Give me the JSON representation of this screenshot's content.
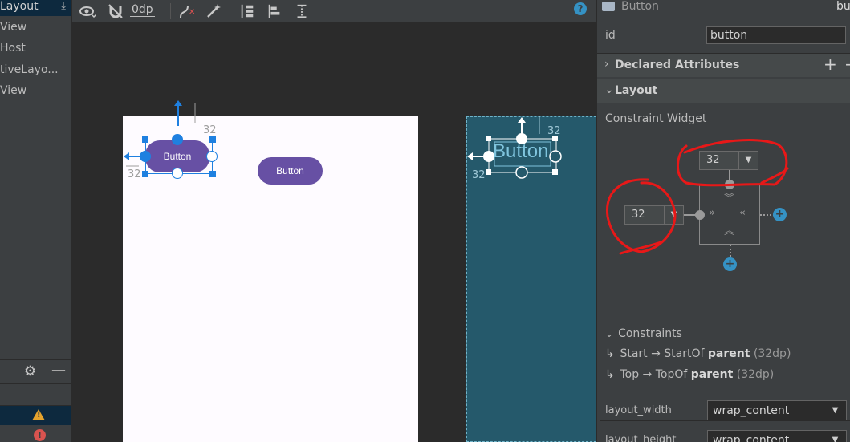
{
  "component_tree": {
    "items": [
      "Layout",
      "View",
      "Host",
      "tiveLayo...",
      "View"
    ]
  },
  "toolbar": {
    "default_margin": "0dp",
    "help": "?"
  },
  "canvas": {
    "selected_button_label": "Button",
    "second_button_label": "Button",
    "blueprint_button_label": "Button",
    "margin_top": "32",
    "margin_start": "32",
    "bp_margin_top": "32",
    "bp_margin_start": "32"
  },
  "attributes": {
    "component_name": "Button",
    "component_id_truncated": "bu",
    "id_label": "id",
    "id_value": "button",
    "sections": {
      "declared": "Declared Attributes",
      "layout": "Layout"
    },
    "constraint_widget_label": "Constraint Widget",
    "top_margin": "32",
    "start_margin": "32",
    "constraints_header": "Constraints",
    "constraints": [
      {
        "side": "Start",
        "arrow": "→",
        "target": "StartOf",
        "parent": "parent",
        "dp": "(32dp)"
      },
      {
        "side": "Top",
        "arrow": "→",
        "target": "TopOf",
        "parent": "parent",
        "dp": "(32dp)"
      }
    ],
    "layout_width_label": "layout_width",
    "layout_width_value": "wrap_content",
    "layout_height_label": "layout_height",
    "layout_height_value": "wrap_content"
  },
  "colors": {
    "accent": "#1f80e0",
    "button": "#6750a4",
    "annotation": "#e81818",
    "blueprint": "#25596b"
  }
}
